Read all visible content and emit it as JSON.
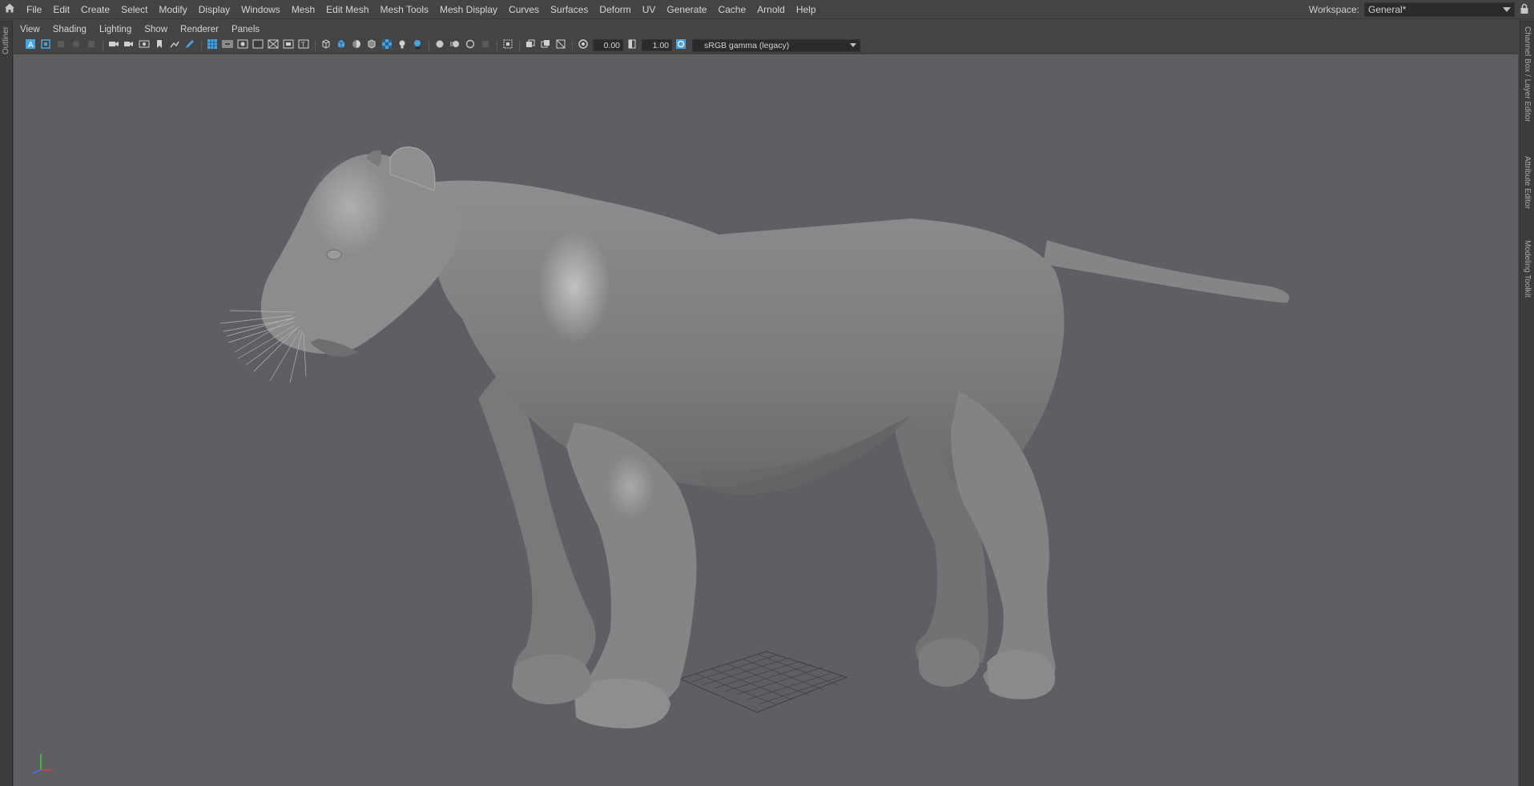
{
  "menubar": {
    "items": [
      "File",
      "Edit",
      "Create",
      "Select",
      "Modify",
      "Display",
      "Windows",
      "Mesh",
      "Edit Mesh",
      "Mesh Tools",
      "Mesh Display",
      "Curves",
      "Surfaces",
      "Deform",
      "UV",
      "Generate",
      "Cache",
      "Arnold",
      "Help"
    ],
    "home_icon": "home-icon"
  },
  "workspace": {
    "label": "Workspace:",
    "value": "General*",
    "lock_icon": "lock-icon"
  },
  "left_panel": {
    "tab": "Outliner"
  },
  "right_panel": {
    "tabs": [
      "Channel Box / Layer Editor",
      "Attribute Editor",
      "Modeling Toolkit"
    ]
  },
  "panel_menu": {
    "items": [
      "View",
      "Shading",
      "Lighting",
      "Show",
      "Renderer",
      "Panels"
    ]
  },
  "panel_toolbar": {
    "exposure": "0.00",
    "gamma": "1.00",
    "color_space": "sRGB gamma (legacy)"
  },
  "viewport": {
    "background_color": "#5f5f63",
    "model_color": "#8a8a8c",
    "axis_colors": {
      "x": "#d94040",
      "y": "#3fcf3f",
      "z": "#4a6cff"
    }
  }
}
